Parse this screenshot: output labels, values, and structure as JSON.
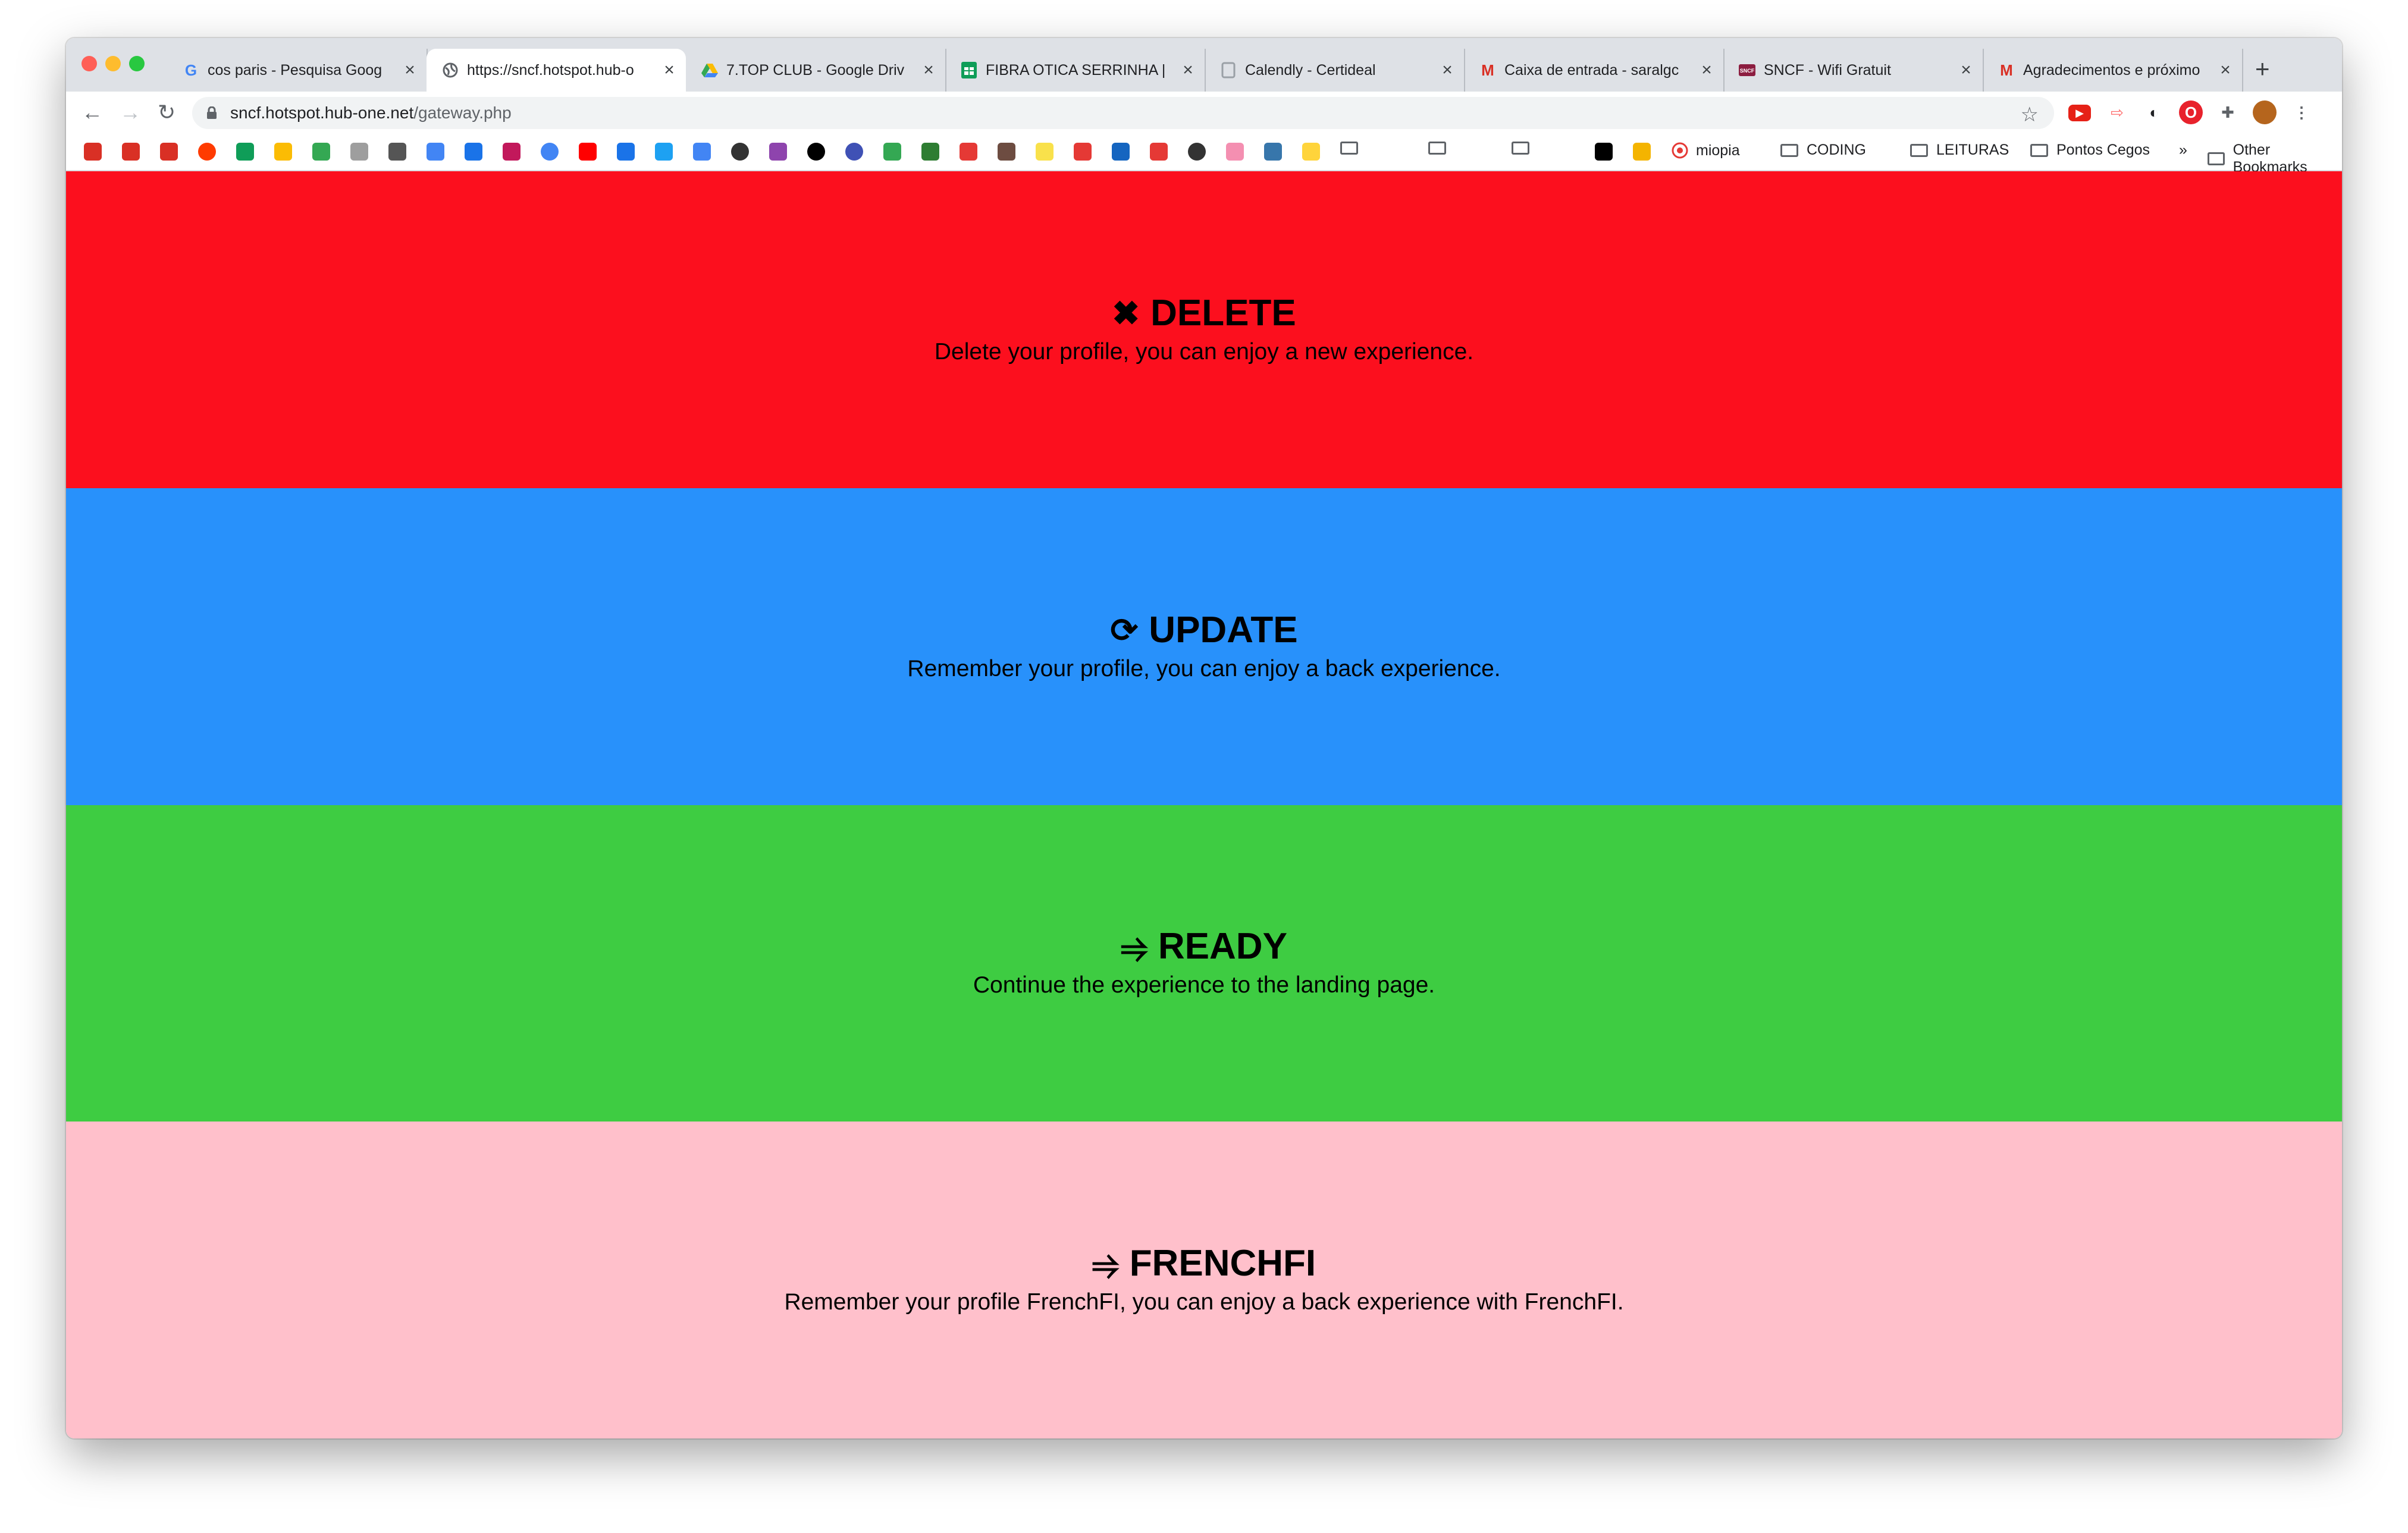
{
  "tabs": [
    {
      "title": "cos paris - Pesquisa Goog",
      "favicon": "google-icon",
      "active": false
    },
    {
      "title": "https://sncf.hotspot.hub-o",
      "favicon": "globe-icon",
      "active": true
    },
    {
      "title": "7.TOP CLUB - Google Driv",
      "favicon": "drive-icon",
      "active": false
    },
    {
      "title": "FIBRA OTICA SERRINHA |",
      "favicon": "sheets-icon",
      "active": false
    },
    {
      "title": "Calendly - Certideal",
      "favicon": "page-icon",
      "active": false
    },
    {
      "title": "Caixa de entrada - saralgc",
      "favicon": "gmail-icon",
      "active": false
    },
    {
      "title": "SNCF - Wifi Gratuit",
      "favicon": "sncf-icon",
      "active": false
    },
    {
      "title": "Agradecimentos e próximo",
      "favicon": "gmail-icon",
      "active": false
    }
  ],
  "tab_close_glyph": "×",
  "new_tab_glyph": "+",
  "address": {
    "host": "sncf.hotspot.hub-one.net",
    "path": "/gateway.php"
  },
  "bookmarks": {
    "labeled": [
      {
        "label": "miopia",
        "icon": "target-icon"
      },
      {
        "label": "CODING",
        "icon": "folder-icon"
      },
      {
        "label": "LEITURAS",
        "icon": "folder-icon"
      },
      {
        "label": "Pontos Cegos",
        "icon": "folder-icon"
      }
    ],
    "overflow": "»",
    "other": "Other Bookmarks"
  },
  "panels": [
    {
      "key": "delete",
      "icon": "✖",
      "title": "DELETE",
      "description": "Delete your profile, you can enjoy a new experience.",
      "color": "#fc0f1e"
    },
    {
      "key": "update",
      "icon": "⟳",
      "title": "UPDATE",
      "description": "Remember your profile, you can enjoy a back experience.",
      "color": "#2891fb"
    },
    {
      "key": "ready",
      "icon": "⥤",
      "title": "READY",
      "description": "Continue the experience to the landing page.",
      "color": "#3ecc42"
    },
    {
      "key": "frenchfi",
      "icon": "⥤",
      "title": "FRENCHFI",
      "description": "Remember your profile FrenchFI, you can enjoy a back experience with FrenchFI.",
      "color": "#ffc0cb"
    }
  ]
}
